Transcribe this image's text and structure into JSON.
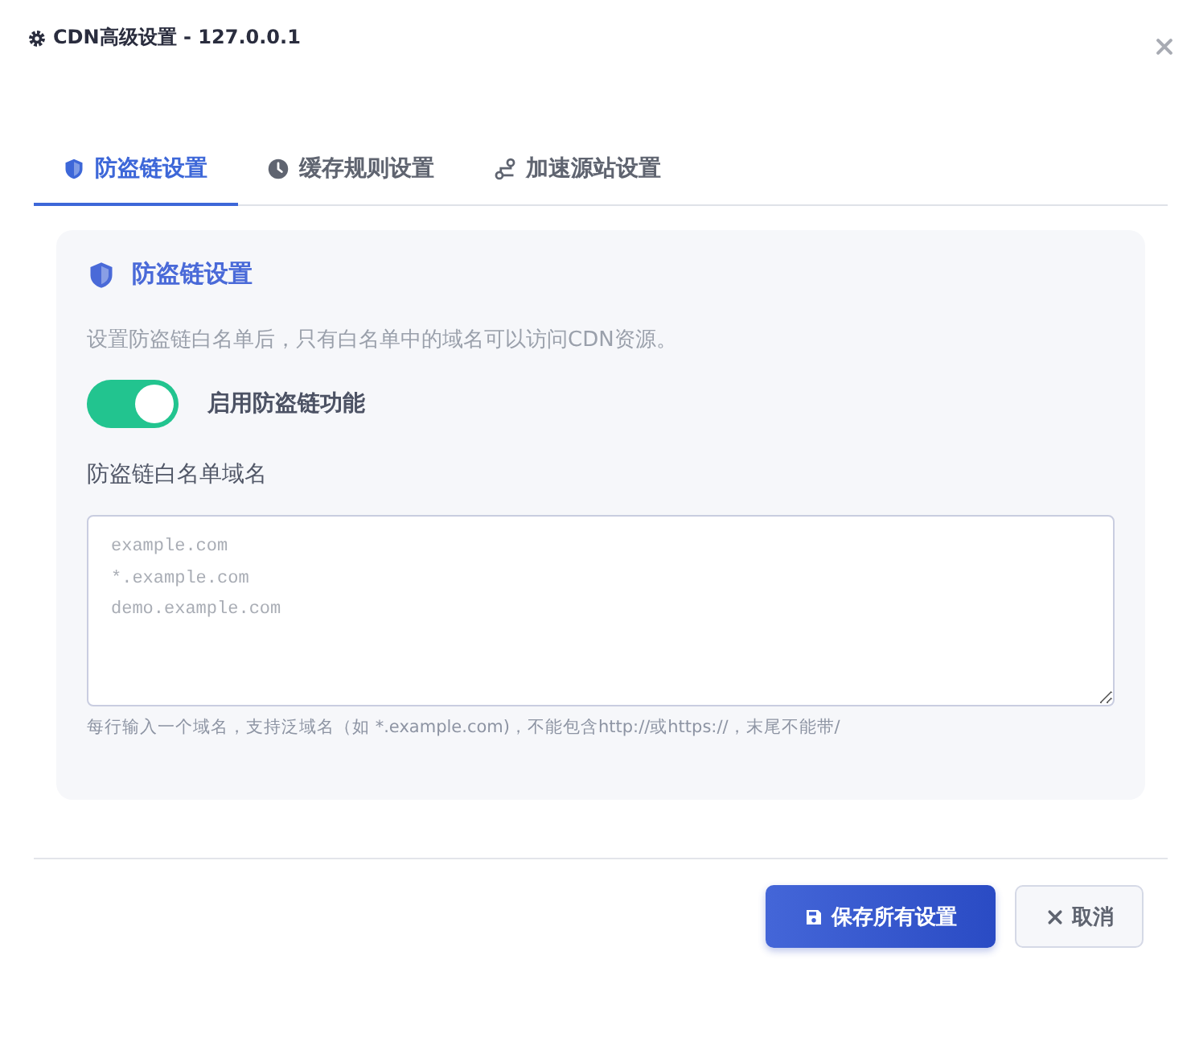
{
  "window": {
    "title": "CDN高级设置 - 127.0.0.1"
  },
  "tabs": [
    {
      "label": "防盗链设置",
      "selected": true
    },
    {
      "label": "缓存规则设置",
      "selected": false
    },
    {
      "label": "加速源站设置",
      "selected": false
    }
  ],
  "panel": {
    "title": "防盗链设置",
    "description": "设置防盗链白名单后，只有白名单中的域名可以访问CDN资源。",
    "toggle": {
      "label": "启用防盗链功能",
      "on": true
    },
    "field": {
      "label": "防盗链白名单域名",
      "placeholder": "example.com\n*.example.com\ndemo.example.com",
      "hint": "每行输入一个域名，支持泛域名（如 *.example.com)，不能包含http://或https://，末尾不能带/"
    }
  },
  "buttons": [
    {
      "label": "保存所有设置",
      "kind": "primary"
    },
    {
      "label": "取消",
      "kind": "secondary"
    }
  ]
}
